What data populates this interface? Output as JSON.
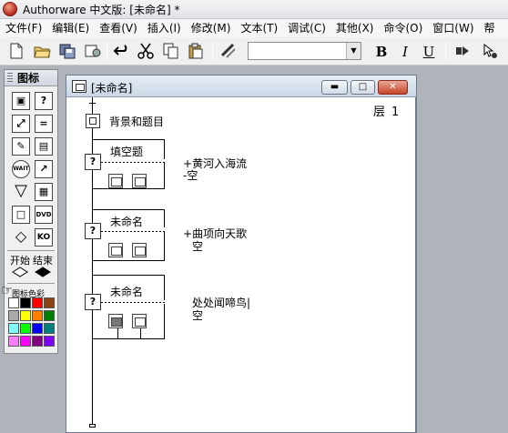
{
  "app": {
    "title": "Authorware 中文版: [未命名] *"
  },
  "menu": [
    "文件(F)",
    "编辑(E)",
    "查看(V)",
    "插入(I)",
    "修改(M)",
    "文本(T)",
    "调试(C)",
    "其他(X)",
    "命令(O)",
    "窗口(W)",
    "帮"
  ],
  "toolbar": {
    "font_value": "",
    "bold_label": "B",
    "italic_label": "I",
    "underline_label": "U"
  },
  "palette": {
    "title": "图标",
    "start_label": "开始",
    "end_label": "结束",
    "color_label": "图标色彩",
    "colors": [
      "#ffffff",
      "#000000",
      "#ff0000",
      "#8b4513",
      "#a9a9a9",
      "#ffff00",
      "#ff8000",
      "#008000",
      "#80ffff",
      "#00ff00",
      "#0000ff",
      "#008080",
      "#ff80ff",
      "#ff00ff",
      "#800080",
      "#8000ff"
    ]
  },
  "design_window": {
    "title": "[未命名]",
    "layer_label": "层",
    "layer_value": "1",
    "min_label": "▬",
    "max_label": "□",
    "close_label": "✕",
    "nodes": [
      {
        "label": "背景和题目"
      },
      {
        "label": "填空题",
        "responses": [
          "黄河入海流",
          "空"
        ]
      },
      {
        "label": "未命名",
        "responses": [
          "曲项向天歌",
          "空"
        ]
      },
      {
        "label": "未命名",
        "responses": [
          "处处闻啼鸟|",
          "空"
        ]
      }
    ]
  }
}
